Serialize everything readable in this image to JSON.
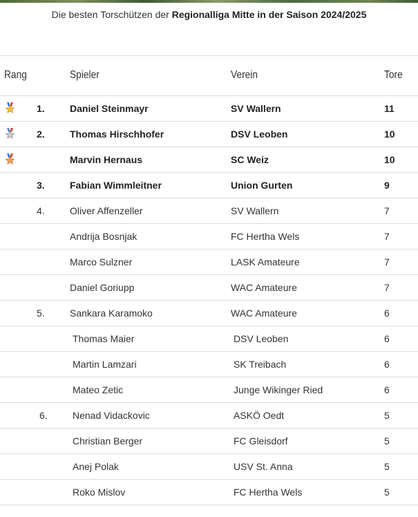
{
  "caption": {
    "prefix": "Die besten Torschützen der ",
    "league": "Regionalliga Mitte in der Saison 2024/2025"
  },
  "headers": {
    "rank": "Rang",
    "player": "Spieler",
    "club": "Verein",
    "goals": "Tore"
  },
  "medals": [
    "gold-medal-icon",
    "silver-medal-icon",
    "bronze-medal-icon"
  ],
  "rows": [
    {
      "rank": "1.",
      "player": "Daniel Steinmayr",
      "club": "SV Wallern",
      "goals": "11",
      "medal": "gold",
      "bold": true
    },
    {
      "rank": "2.",
      "player": "Thomas Hirschhofer",
      "club": "DSV Leoben",
      "goals": "10",
      "medal": "silver",
      "bold": true
    },
    {
      "rank": "",
      "player": "Marvin Hernaus",
      "club": "SC Weiz",
      "goals": "10",
      "medal": "bronze",
      "bold": true
    },
    {
      "rank": "3.",
      "player": "Fabian Wimmleitner",
      "club": "Union Gurten",
      "goals": "9",
      "medal": "",
      "bold": true
    },
    {
      "rank": "4.",
      "player": "Oliver Affenzeller",
      "club": "SV Wallern",
      "goals": "7",
      "medal": "",
      "bold": false
    },
    {
      "rank": "",
      "player": "Andrija Bosnjak",
      "club": "FC Hertha Wels",
      "goals": "7",
      "medal": "",
      "bold": false
    },
    {
      "rank": "",
      "player": "Marco Sulzner",
      "club": "LASK Amateure",
      "goals": "7",
      "medal": "",
      "bold": false
    },
    {
      "rank": "",
      "player": "Daniel Goriupp",
      "club": "WAC Amateure",
      "goals": "7",
      "medal": "",
      "bold": false
    },
    {
      "rank": "5.",
      "player": "Sankara Karamoko",
      "club": "WAC Amateure",
      "goals": "6",
      "medal": "",
      "bold": false
    },
    {
      "rank": "",
      "player": "Thomas Maier",
      "club": "DSV Leoben",
      "goals": "6",
      "medal": "",
      "bold": false
    },
    {
      "rank": "",
      "player": "Martin Lamzari",
      "club": "SK Treibach",
      "goals": "6",
      "medal": "",
      "bold": false
    },
    {
      "rank": "",
      "player": "Mateo Zetic",
      "club": "Junge Wikinger Ried",
      "goals": "6",
      "medal": "",
      "bold": false
    },
    {
      "rank": "6.",
      "player": "Nenad Vidackovic",
      "club": "ASKÖ Oedt",
      "goals": "5",
      "medal": "",
      "bold": false
    },
    {
      "rank": "",
      "player": "Christian Berger",
      "club": "FC Gleisdorf",
      "goals": "5",
      "medal": "",
      "bold": false
    },
    {
      "rank": "",
      "player": "Anej Polak",
      "club": "USV St. Anna",
      "goals": "5",
      "medal": "",
      "bold": false
    },
    {
      "rank": "",
      "player": "Roko Mislov",
      "club": "FC Hertha Wels",
      "goals": "5",
      "medal": "",
      "bold": false
    }
  ]
}
